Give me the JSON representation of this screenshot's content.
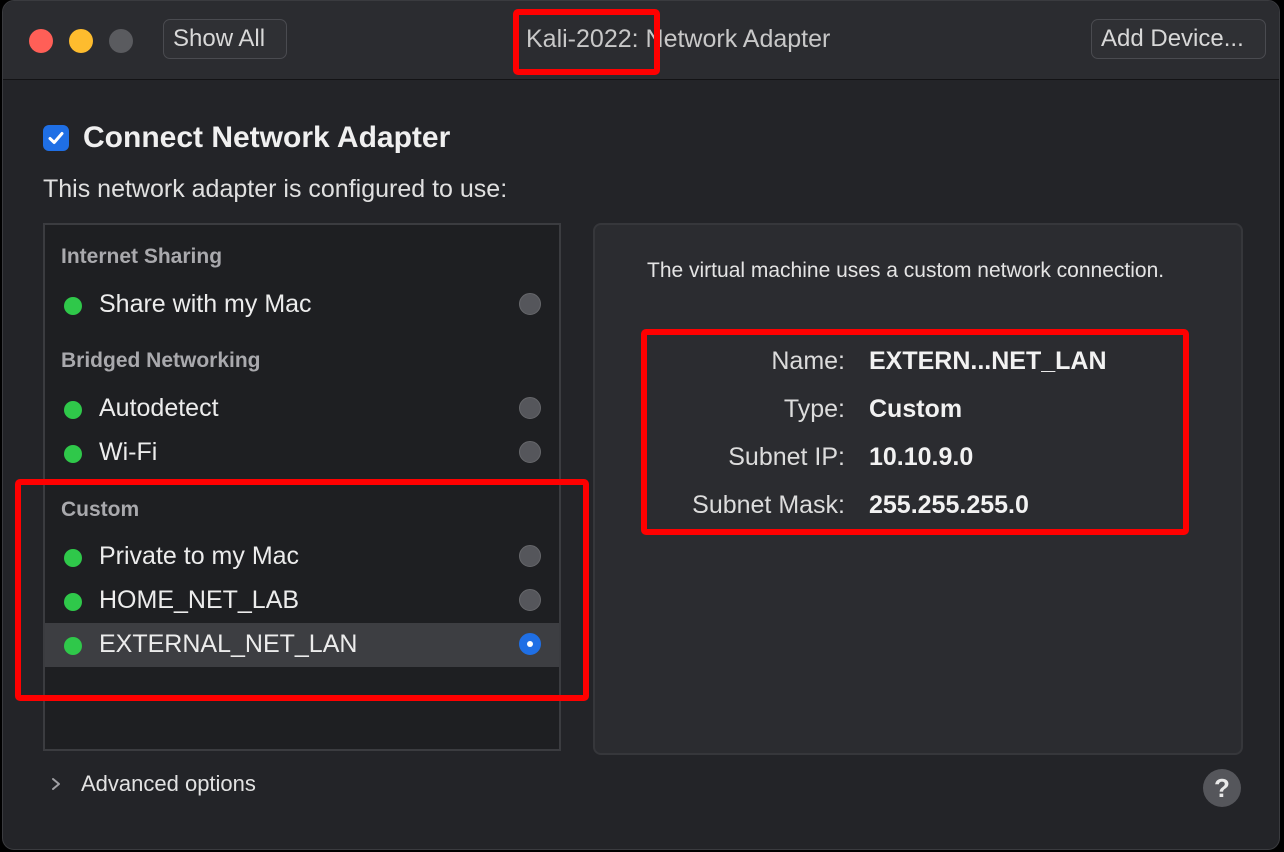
{
  "window": {
    "title": "Kali-2022: Network Adapter",
    "show_all_label": "Show All",
    "add_device_label": "Add Device..."
  },
  "connect": {
    "label": "Connect Network Adapter",
    "checked": true
  },
  "configured_text": "This network adapter is configured to use:",
  "sections": {
    "internet_sharing": {
      "heading": "Internet Sharing",
      "items": [
        {
          "label": "Share with my Mac",
          "selected": false
        }
      ]
    },
    "bridged": {
      "heading": "Bridged Networking",
      "items": [
        {
          "label": "Autodetect",
          "selected": false
        },
        {
          "label": "Wi-Fi",
          "selected": false
        }
      ]
    },
    "custom": {
      "heading": "Custom",
      "items": [
        {
          "label": "Private to my Mac",
          "selected": false
        },
        {
          "label": "HOME_NET_LAB",
          "selected": false
        },
        {
          "label": "EXTERNAL_NET_LAN",
          "selected": true
        }
      ]
    }
  },
  "detail": {
    "description": "The virtual machine uses a custom network connection.",
    "fields": [
      {
        "key": "Name:",
        "value": "EXTERN...NET_LAN"
      },
      {
        "key": "Type:",
        "value": "Custom"
      },
      {
        "key": "Subnet IP:",
        "value": "10.10.9.0"
      },
      {
        "key": "Subnet Mask:",
        "value": "255.255.255.0"
      }
    ]
  },
  "advanced_label": "Advanced options",
  "help_label": "?",
  "colors": {
    "accent": "#1f6fe5",
    "status_green": "#2fc84a",
    "highlight_red": "#ff0000"
  }
}
